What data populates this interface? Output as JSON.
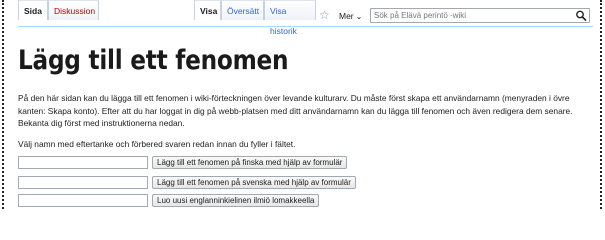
{
  "tabs": {
    "left": [
      {
        "label": "Sida",
        "selected": true
      },
      {
        "label": "Diskussion",
        "selected": false
      }
    ],
    "right": [
      {
        "label": "Visa",
        "selected": true
      },
      {
        "label": "Översätt",
        "selected": false
      },
      {
        "label": "Visa historik",
        "selected": false
      }
    ],
    "more_label": "Mer"
  },
  "search": {
    "placeholder": "Sök på Elävä perintö -wiki"
  },
  "page": {
    "title": "Lägg till ett fenomen",
    "intro": "På den här sidan kan du lägga till ett fenomen i wiki-förteckningen över levande kulturarv. Du måste först skapa ett användarnamn (menyraden i övre kanten: Skapa konto). Efter att du har loggat in dig på webb-platsen med ditt användarnamn kan du lägga till fenomen och även redigera dem senare. Bekanta dig först med instruktionerna nedan.",
    "hint": "Välj namn med eftertanke och förbered svaren redan innan du fyller i fältet."
  },
  "forms": [
    {
      "button": "Lägg till ett fenomen på finska med hjälp av formulär",
      "value": ""
    },
    {
      "button": "Lägg till ett fenomen på svenska med hjälp av formulär",
      "value": ""
    },
    {
      "button": "Luo uusi englanninkielinen ilmiö lomakkeella",
      "value": ""
    }
  ],
  "colors": {
    "link": "#3366cc",
    "new_link": "#ba0000",
    "text": "#202122",
    "tab_border": "#a7d7f9"
  },
  "icons": {
    "watch": "star-icon",
    "search": "magnifier-icon",
    "more": "chevron-down-icon"
  }
}
